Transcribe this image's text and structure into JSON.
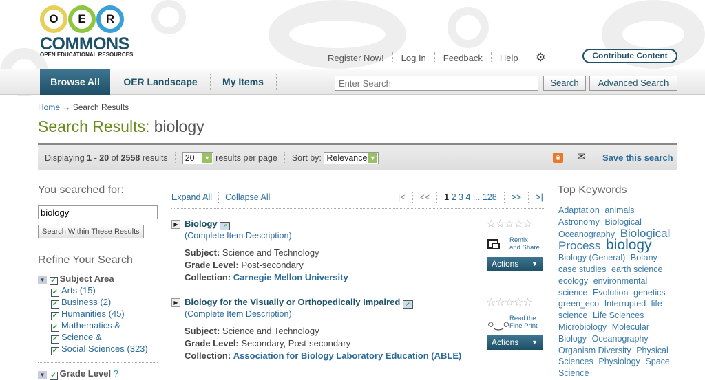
{
  "logo": {
    "letters": [
      "O",
      "E",
      "R"
    ],
    "name": "COMMONS",
    "tagline": "OPEN EDUCATIONAL RESOURCES"
  },
  "top_links": [
    "Register Now!",
    "Log In",
    "Feedback",
    "Help"
  ],
  "contribute": "Contribute Content",
  "nav": {
    "tabs": [
      "Browse All",
      "OER Landscape",
      "My Items"
    ],
    "active": "Browse All"
  },
  "search": {
    "placeholder": "Enter Search",
    "button": "Search",
    "advanced": "Advanced Search"
  },
  "breadcrumb": {
    "home": "Home",
    "arrow": "→",
    "current": "Search Results"
  },
  "title": {
    "prefix": "Search Results:",
    "query": "biology"
  },
  "toolbar": {
    "displaying": "Displaying",
    "from": "1",
    "dash": "-",
    "to": "20",
    "of": "of",
    "total": "2558",
    "results": "results",
    "per_page_value": "20",
    "per_page_label": "results per page",
    "sort_label": "Sort by:",
    "sort_value": "Relevance",
    "save": "Save this search"
  },
  "left": {
    "searched_heading": "You searched for:",
    "query": "biology",
    "within_button": "Search Within These Results",
    "refine_heading": "Refine Your Search",
    "facet": "Subject Area",
    "options": [
      "Arts (15)",
      "Business (2)",
      "Humanities (45)",
      "Mathematics &",
      "Science &",
      "Social Sciences (323)"
    ],
    "next_facet": "Grade Level"
  },
  "middle": {
    "expand": "Expand All",
    "collapse": "Collapse All",
    "pager": {
      "first": "|<",
      "prev": "<<",
      "pages": [
        "1",
        "2",
        "3",
        "4"
      ],
      "ellipsis": "...",
      "last_page": "128",
      "next": ">>",
      "last": ">|",
      "current": "1"
    }
  },
  "labels": {
    "subject": "Subject:",
    "grade": "Grade Level:",
    "collection": "Collection:",
    "desc": "(Complete Item Description)",
    "actions": "Actions"
  },
  "results": [
    {
      "title": "Biology",
      "subject": "Science and Technology",
      "grade": "Post-secondary",
      "collection": "Carnegie Mellon University",
      "badge": [
        "Remix",
        "and Share"
      ],
      "badge_icon": "remix-icon",
      "rating": 0
    },
    {
      "title": "Biology for the Visually or Orthopedically Impaired",
      "subject": "Science and Technology",
      "grade": "Secondary, Post-secondary",
      "collection": "Association for Biology Laboratory Education (ABLE)",
      "badge": [
        "Read the",
        "Fine Print"
      ],
      "badge_icon": "glasses-icon",
      "rating": 0
    }
  ],
  "keywords": {
    "heading": "Top Keywords",
    "items": [
      [
        "Adaptation",
        13
      ],
      [
        "animals",
        13
      ],
      [
        "Astronomy",
        13
      ],
      [
        "Biological Oceanography",
        13
      ],
      [
        "Biological Process",
        17
      ],
      [
        "biology",
        21
      ],
      [
        "Biology (General)",
        13
      ],
      [
        "Botany",
        13
      ],
      [
        "case studies",
        13
      ],
      [
        "earth science",
        13
      ],
      [
        "ecology",
        13
      ],
      [
        "environmental science",
        13
      ],
      [
        "Evolution",
        13
      ],
      [
        "genetics",
        13
      ],
      [
        "green_eco",
        13
      ],
      [
        "Interrupted",
        13
      ],
      [
        "life science",
        13
      ],
      [
        "Life Sciences",
        13
      ],
      [
        "Microbiology",
        13
      ],
      [
        "Molecular Biology",
        13
      ],
      [
        "Oceanography",
        13
      ],
      [
        "Organism Diversity",
        13
      ],
      [
        "Physical Sciences",
        13
      ],
      [
        "Physiology",
        13
      ],
      [
        "Space Science",
        13
      ]
    ]
  },
  "colors": {
    "brand": "#1d5168",
    "title_green": "#6a8a1f",
    "link": "#2a6a9a"
  }
}
